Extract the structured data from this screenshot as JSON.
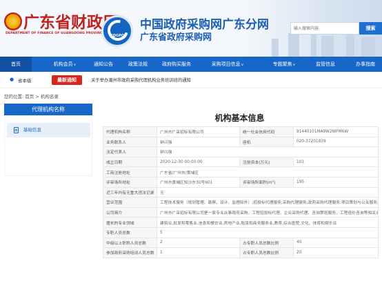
{
  "header": {
    "dept_title": "广东省财政厅",
    "dept_en": "DEPARTMENT OF FINANCE OF GUANGDONG PROVINCE",
    "logo_text": "GDGPO",
    "site_title": "中国政府采购网广东分网",
    "site_subtitle": "广东省政府采购网",
    "search_placeholder": "输入搜索内容",
    "search_button": "搜索"
  },
  "nav": {
    "items": [
      {
        "label": "首页",
        "active": true
      },
      {
        "label": "机构会员",
        "chevron": true
      },
      {
        "label": "通知公告"
      },
      {
        "label": "政策法规"
      },
      {
        "label": "政府购买服务"
      },
      {
        "label": "采购项目信息",
        "chevron": true
      },
      {
        "label": "专题聚焦",
        "chevron": true
      },
      {
        "label": "监管信息"
      },
      {
        "label": "办事指南"
      }
    ]
  },
  "notice": {
    "location": "省本级",
    "badge": "最新通知",
    "text": "关于举办潮州市政府采购代理机构业务培训班的通知"
  },
  "breadcrumb": "您的位置: 首页 > 机构名录",
  "sidebar": {
    "title": "代理机构名称",
    "item_label": "基础信息"
  },
  "main": {
    "title": "机构基本信息",
    "rows": [
      {
        "l1": "代理机构名称",
        "v1": "广州市广采招标有限公司",
        "l2": "统一社会信用代码",
        "v2": "91440101MA9W2WFM6W"
      },
      {
        "l1": "业务联系人",
        "v1": "钟兴强",
        "l2": "座机",
        "v2": "020-37201839"
      },
      {
        "l1": "法定代表人",
        "v1": "钟兴强"
      },
      {
        "l1": "成立日期",
        "v1": "2020-12-30 00:00:00",
        "l2": "注册资本(万元)",
        "v2": "101"
      },
      {
        "l1": "工商注册地址",
        "v1": "广东省/广州市/黄埔区"
      },
      {
        "l1": "评审场所地址",
        "v1": "广州市黄埔区知沙东30号601",
        "l2": "评审场所面积(m²)",
        "v2": "195"
      },
      {
        "l1": "近三年内有无重大违法记录",
        "v1": "无"
      },
      {
        "l1": "营业范围",
        "v1": "工程技术服务（规划管理、勘察、设计、监理除外）;招投标代理服务;采购代理服务;政府采购代理服务;项目策划与公关服务;企业..."
      },
      {
        "l1": "公司简介",
        "v1": "广州市广采招标有限公司是一家专业从事政府采购、工程招投标代理、企业采购代理、咨询策划服务、工程造价咨询等相关业务的专业..."
      },
      {
        "l1": "擅长的专业领域",
        "v1": "建筑业,批发和零售业,信息和餐饮业,房地产业,租赁和商务服务业,教育,综合医院,文化、体育和娱乐业"
      },
      {
        "l1": "专职人员总数",
        "v1": "5"
      },
      {
        "l1": "中级以上职称人员总数",
        "v1": "2",
        "l2": "占专职人员总数比例",
        "v2": "40"
      },
      {
        "l1": "参加政府采购培训人员总数",
        "v1": "1",
        "l2": "占专职人员总数比例",
        "v2": "20"
      }
    ]
  }
}
